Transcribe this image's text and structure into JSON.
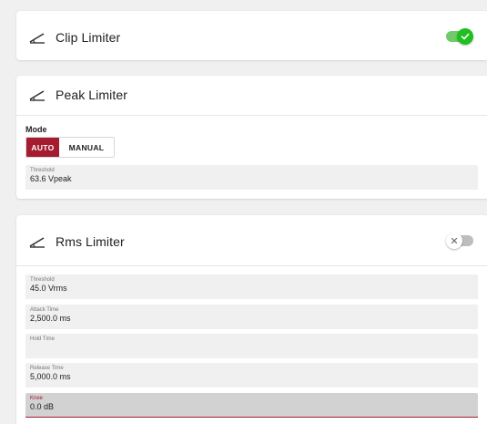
{
  "clip_limiter": {
    "title": "Clip Limiter",
    "enabled": true
  },
  "peak_limiter": {
    "title": "Peak Limiter",
    "mode_label": "Mode",
    "mode_options": [
      "AUTO",
      "MANUAL"
    ],
    "mode_selected": "AUTO",
    "threshold": {
      "label": "Threshold",
      "value": "63.6  Vpeak"
    }
  },
  "rms_limiter": {
    "title": "Rms Limiter",
    "enabled": false,
    "threshold": {
      "label": "Threshold",
      "value": "45.0  Vrms"
    },
    "attack_time": {
      "label": "Attack Time",
      "value": "2,500.0  ms"
    },
    "hold_time": {
      "label": "Hold Time",
      "value": ""
    },
    "release_time": {
      "label": "Release Time",
      "value": "5,000.0  ms"
    },
    "knee": {
      "label": "Knee",
      "value": "0.0  dB"
    }
  },
  "colors": {
    "accent": "#a51c30",
    "toggle_on": "#1fbf1f",
    "field_bg": "#f0f0f0"
  },
  "icons": {
    "limiter": "gauge-needle-icon",
    "check": "check-icon",
    "close": "close-icon"
  }
}
